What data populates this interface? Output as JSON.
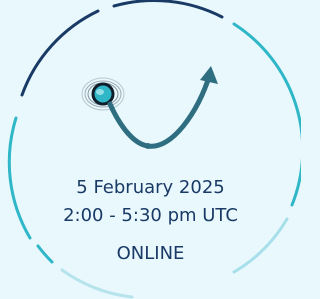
{
  "event": {
    "date": "5 February 2025",
    "time": "2:00 - 5:30 pm UTC",
    "mode": "ONLINE"
  },
  "colors": {
    "background": "#e8f8fd",
    "navy": "#1a3a66",
    "teal": "#2fb7c8",
    "dark_teal": "#2f6e80"
  },
  "logo": {
    "icon": "orbit-arrow-logo"
  }
}
